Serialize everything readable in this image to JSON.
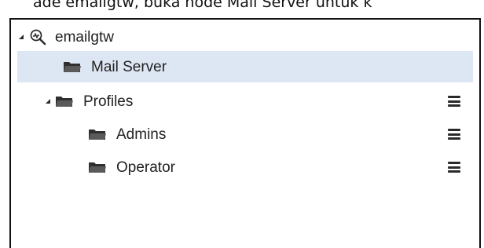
{
  "caption": {
    "text": "ade emailgtw, buka node Mail Server untuk k"
  },
  "tree": {
    "root": {
      "label": "emailgtw",
      "icon": "gateway-search-icon",
      "expanded": true
    },
    "items": [
      {
        "label": "Mail Server",
        "icon": "folder-icon",
        "selected": true,
        "has_menu": false
      },
      {
        "label": "Profiles",
        "icon": "folder-icon",
        "expanded": true,
        "has_menu": true
      },
      {
        "label": "Admins",
        "icon": "folder-icon",
        "has_menu": true
      },
      {
        "label": "Operator",
        "icon": "folder-icon",
        "has_menu": true
      }
    ]
  },
  "colors": {
    "selection": "#dde6f3",
    "border": "#111111",
    "folder": "#2f2f2f"
  }
}
